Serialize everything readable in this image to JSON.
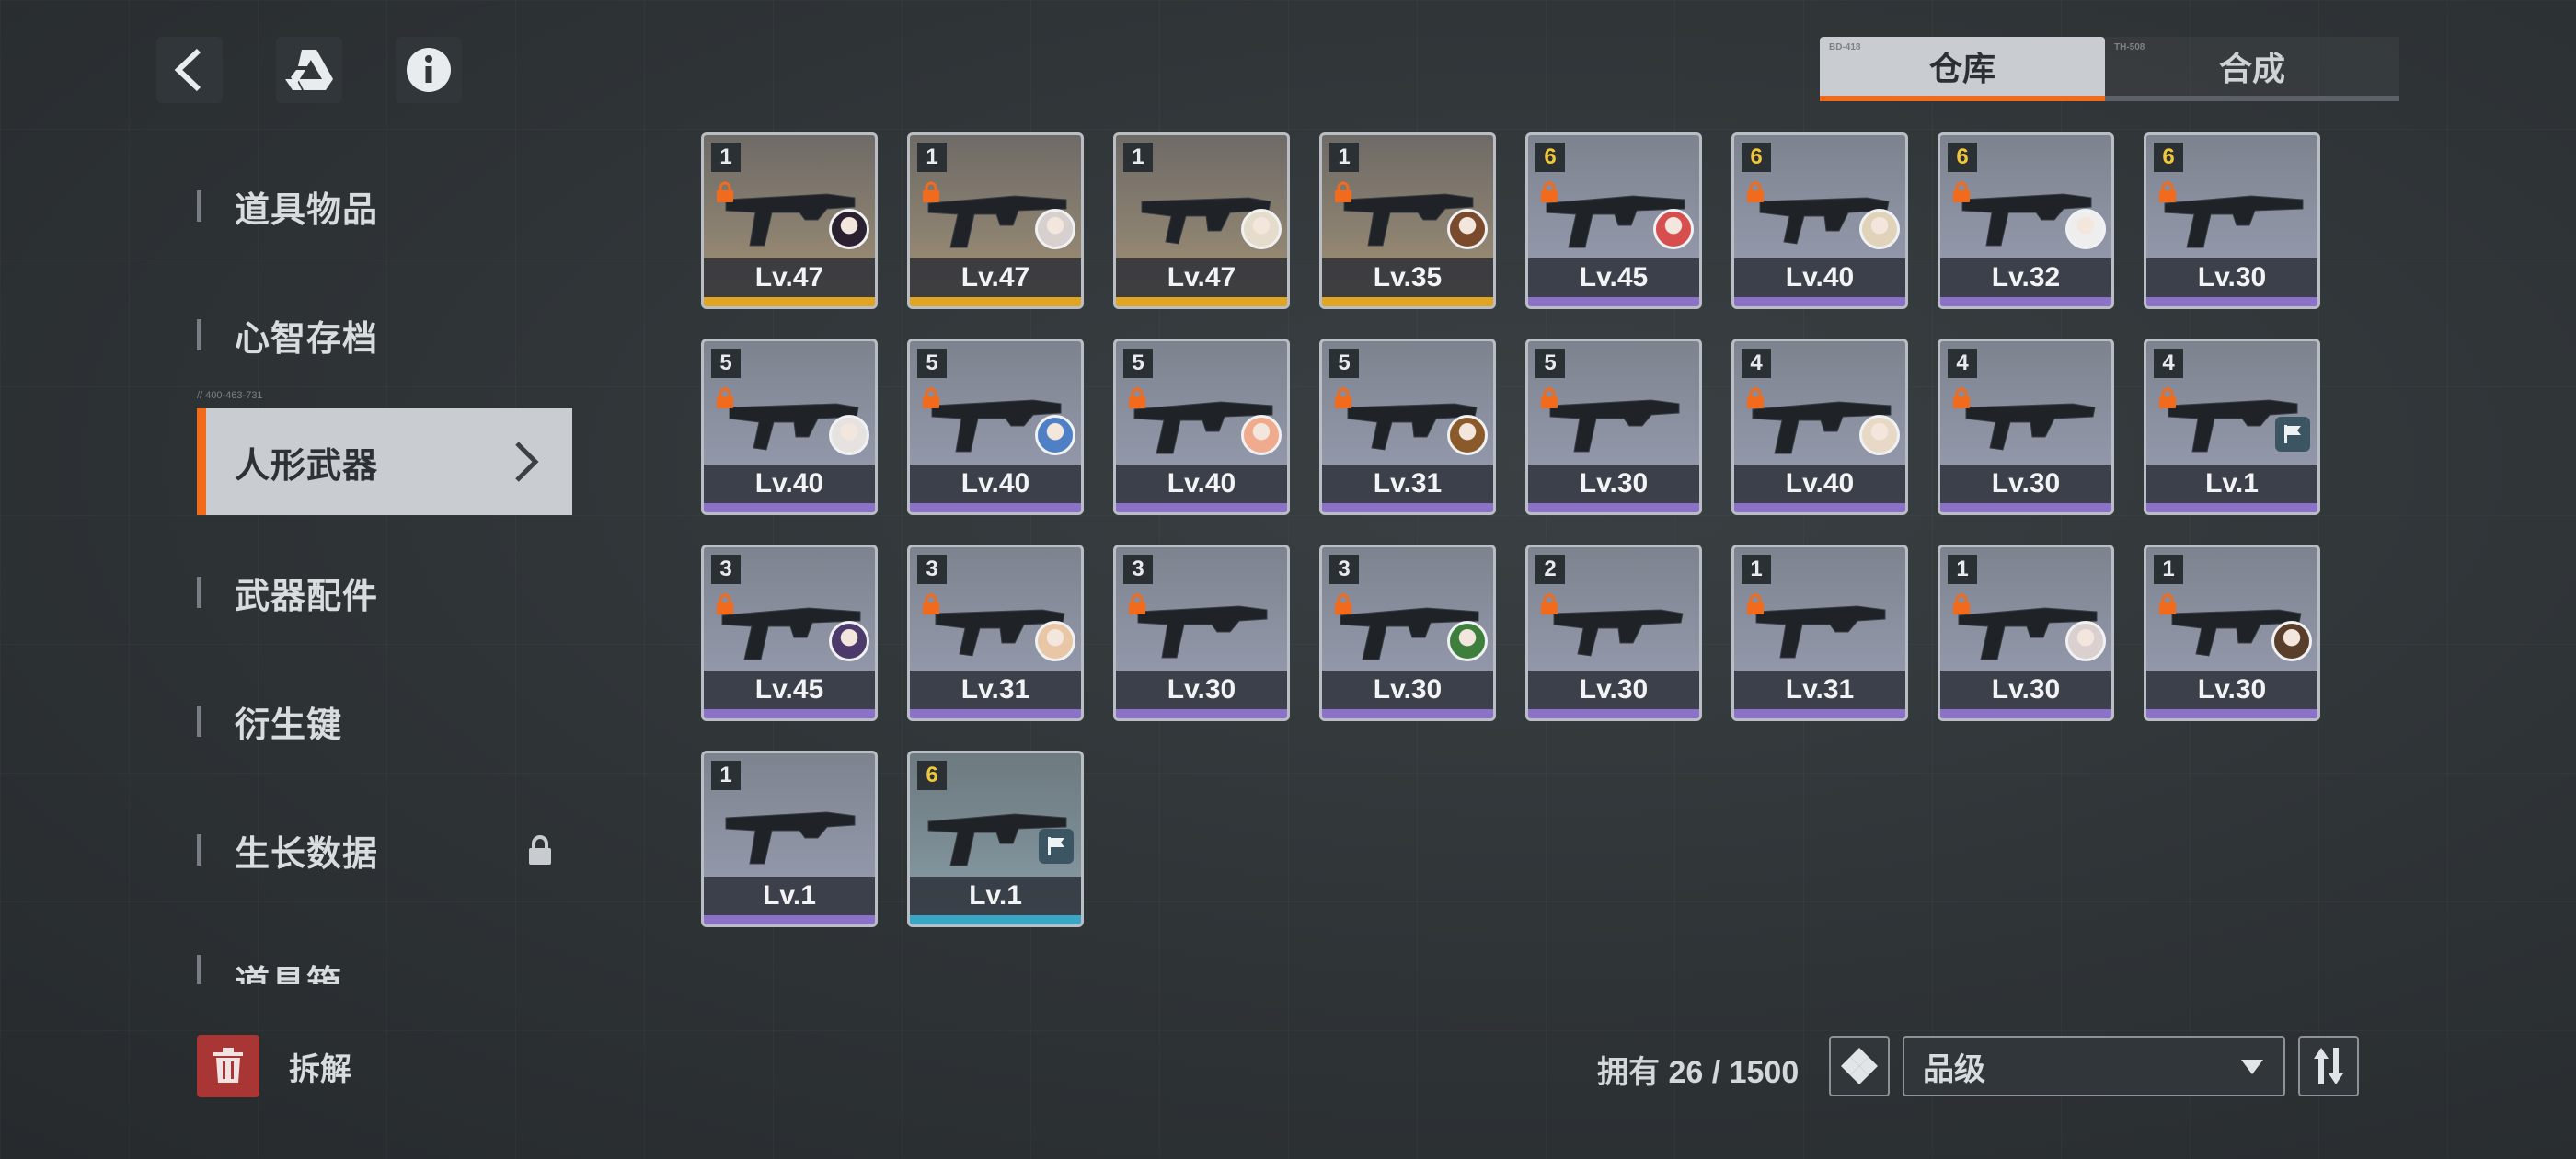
{
  "tabs": [
    {
      "label": "仓库",
      "tag": "BD-418",
      "active": true
    },
    {
      "label": "合成",
      "tag": "TH-508",
      "active": false
    }
  ],
  "top_buttons": [
    {
      "icon": "back-arrow-icon"
    },
    {
      "icon": "drive-triangle-icon"
    },
    {
      "icon": "info-icon"
    }
  ],
  "sidebar": {
    "tag": "// 400-463-731",
    "items": [
      {
        "label": "道具物品"
      },
      {
        "label": "心智存档"
      },
      {
        "label": "人形武器",
        "active": true
      },
      {
        "label": "武器配件"
      },
      {
        "label": "衍生键"
      },
      {
        "label": "生长数据",
        "locked": true
      },
      {
        "label": "道具箱"
      }
    ]
  },
  "weapons": [
    {
      "rank": "1",
      "level": "Lv.47",
      "rarity": "gold",
      "locked": true,
      "portrait": "#2a2030"
    },
    {
      "rank": "1",
      "level": "Lv.47",
      "rarity": "gold",
      "locked": true,
      "portrait": "#d8d0cf"
    },
    {
      "rank": "1",
      "level": "Lv.47",
      "rarity": "gold",
      "locked": false,
      "portrait": "#e5dccb"
    },
    {
      "rank": "1",
      "level": "Lv.35",
      "rarity": "gold",
      "locked": true,
      "portrait": "#7a4a2d"
    },
    {
      "rank": "6",
      "level": "Lv.45",
      "rarity": "purple",
      "locked": true,
      "portrait": "#d64e4e"
    },
    {
      "rank": "6",
      "level": "Lv.40",
      "rarity": "purple",
      "locked": true,
      "portrait": "#e0d3b9"
    },
    {
      "rank": "6",
      "level": "Lv.32",
      "rarity": "purple",
      "locked": true,
      "portrait": "#eeeeee"
    },
    {
      "rank": "6",
      "level": "Lv.30",
      "rarity": "purple",
      "locked": true,
      "portrait": null
    },
    {
      "rank": "5",
      "level": "Lv.40",
      "rarity": "purple",
      "locked": true,
      "portrait": "#e6e2e0"
    },
    {
      "rank": "5",
      "level": "Lv.40",
      "rarity": "purple",
      "locked": true,
      "portrait": "#4f7fc4"
    },
    {
      "rank": "5",
      "level": "Lv.40",
      "rarity": "purple",
      "locked": true,
      "portrait": "#f0ab8e"
    },
    {
      "rank": "5",
      "level": "Lv.31",
      "rarity": "purple",
      "locked": true,
      "portrait": "#8a5a2a"
    },
    {
      "rank": "5",
      "level": "Lv.30",
      "rarity": "purple",
      "locked": true,
      "portrait": null
    },
    {
      "rank": "4",
      "level": "Lv.40",
      "rarity": "purple",
      "locked": true,
      "portrait": "#e8d9c7"
    },
    {
      "rank": "4",
      "level": "Lv.30",
      "rarity": "purple",
      "locked": true,
      "portrait": null
    },
    {
      "rank": "4",
      "level": "Lv.1",
      "rarity": "purple",
      "locked": true,
      "portrait": null,
      "flag": true
    },
    {
      "rank": "3",
      "level": "Lv.45",
      "rarity": "purple",
      "locked": true,
      "portrait": "#4c3a6a"
    },
    {
      "rank": "3",
      "level": "Lv.31",
      "rarity": "purple",
      "locked": true,
      "portrait": "#e9c7a6"
    },
    {
      "rank": "3",
      "level": "Lv.30",
      "rarity": "purple",
      "locked": true,
      "portrait": null
    },
    {
      "rank": "3",
      "level": "Lv.30",
      "rarity": "purple",
      "locked": true,
      "portrait": "#3e7f3e"
    },
    {
      "rank": "2",
      "level": "Lv.30",
      "rarity": "purple",
      "locked": true,
      "portrait": null
    },
    {
      "rank": "1",
      "level": "Lv.31",
      "rarity": "purple",
      "locked": true,
      "portrait": null
    },
    {
      "rank": "1",
      "level": "Lv.30",
      "rarity": "purple",
      "locked": true,
      "portrait": "#d9d0cf"
    },
    {
      "rank": "1",
      "level": "Lv.30",
      "rarity": "purple",
      "locked": true,
      "portrait": "#5a3e2c"
    },
    {
      "rank": "1",
      "level": "Lv.1",
      "rarity": "purple",
      "locked": false,
      "portrait": null
    },
    {
      "rank": "6",
      "level": "Lv.1",
      "rarity": "teal",
      "locked": false,
      "portrait": null,
      "flag": true
    }
  ],
  "rarity_colors": {
    "gold": "#e1a524",
    "purple": "#8b72c8",
    "teal": "#3aa6c6"
  },
  "accent_color": "#f26a1b",
  "bottom": {
    "dismantle_label": "拆解",
    "owned_text": "拥有 26 / 1500",
    "sort_value": "品级"
  }
}
